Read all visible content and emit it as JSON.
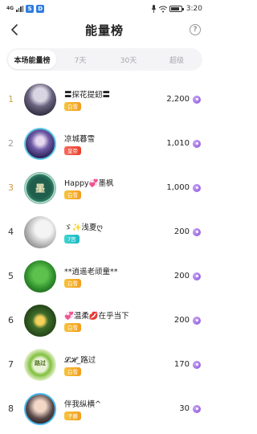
{
  "status_bar": {
    "time": "3:20",
    "sim_icons": [
      "S",
      "D"
    ],
    "network_label": "4G"
  },
  "header": {
    "title": "能量榜",
    "help_label": "?"
  },
  "tabs": [
    {
      "label": "本场能量榜",
      "active": true
    },
    {
      "label": "7天",
      "active": false
    },
    {
      "label": "30天",
      "active": false
    },
    {
      "label": "超级",
      "active": false
    }
  ],
  "ranking": [
    {
      "rank": "1",
      "name": "〓探花提釰〓",
      "badge": "白雪",
      "badge_color": "gold",
      "score": "2,200",
      "avatar_icon": "user-avatar-icon"
    },
    {
      "rank": "2",
      "name": "凉城暮雪",
      "badge": "皇帝",
      "badge_color": "red",
      "score": "1,010",
      "avatar_icon": "user-avatar-icon"
    },
    {
      "rank": "3",
      "name": "Happy💞墨枫",
      "badge": "白雪",
      "badge_color": "gold",
      "score": "1,000",
      "avatar_icon": "user-avatar-icon",
      "avatar_text": "墨"
    },
    {
      "rank": "4",
      "name": "ゞ✨浅夏ღ",
      "badge": "7宫",
      "badge_color": "cyan",
      "score": "200",
      "avatar_icon": "user-avatar-icon"
    },
    {
      "rank": "5",
      "name": "**逍遥老顽童**",
      "badge": "白雪",
      "badge_color": "gold",
      "score": "200",
      "avatar_icon": "user-avatar-icon"
    },
    {
      "rank": "6",
      "name": "💞温柔💋在乎当下",
      "badge": "白雪",
      "badge_color": "gold",
      "score": "200",
      "avatar_icon": "user-avatar-icon"
    },
    {
      "rank": "7",
      "name": "𝓛𝓗_路过",
      "badge": "白雪",
      "badge_color": "gold",
      "score": "170",
      "avatar_icon": "user-avatar-icon",
      "avatar_text": "路过"
    },
    {
      "rank": "8",
      "name": "伴我纵横^",
      "badge": "子爵",
      "badge_color": "gold",
      "score": "30",
      "avatar_icon": "user-avatar-icon"
    }
  ],
  "colors": {
    "rank_gold": "#c8a646",
    "accent_purple": "#8a4fdc",
    "tab_bg": "#f4f4f6"
  }
}
